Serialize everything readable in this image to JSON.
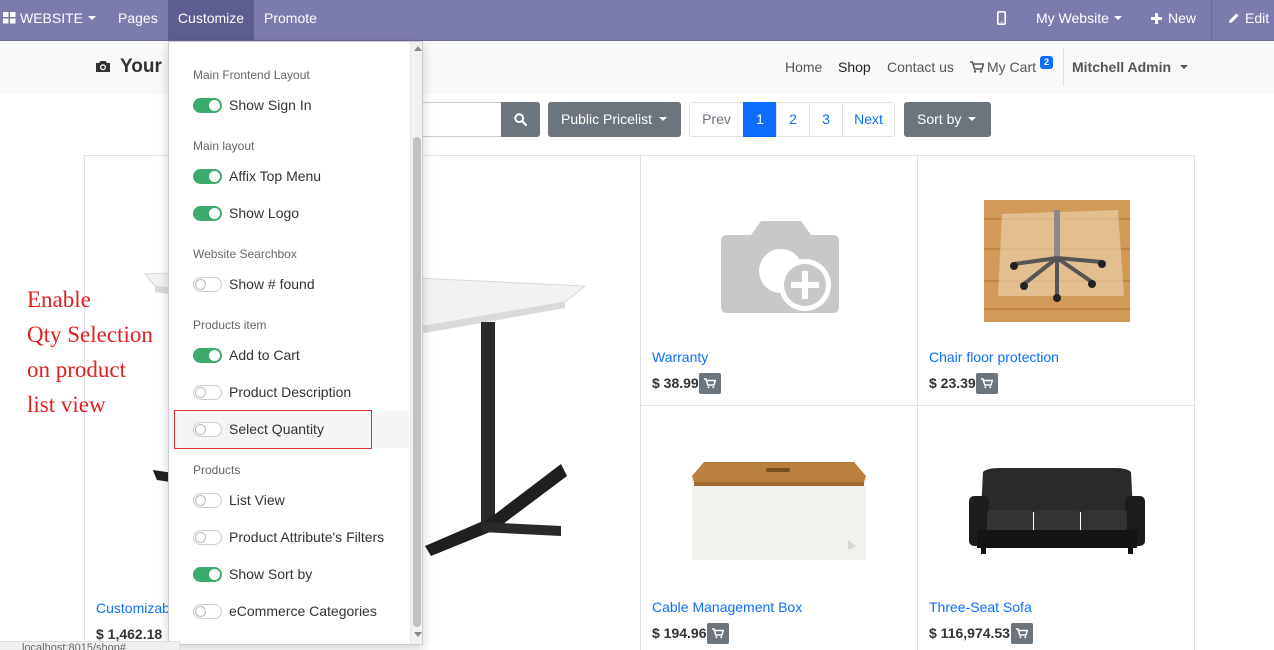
{
  "admin_bar": {
    "website_menu": "WEBSITE",
    "pages": "Pages",
    "customize": "Customize",
    "promote": "Promote",
    "website_selector": "My Website",
    "new": "New",
    "edit": "Edit"
  },
  "site_header": {
    "logo": "Your",
    "nav": [
      "Home",
      "Shop",
      "Contact us"
    ],
    "active_nav": "Shop",
    "cart_label": "My Cart",
    "cart_count": "2",
    "user": "Mitchell Admin"
  },
  "shop_toolbar": {
    "pricelist": "Public Pricelist",
    "pager": [
      "Prev",
      "1",
      "2",
      "3",
      "Next"
    ],
    "current_page": "1",
    "sort": "Sort by"
  },
  "products": [
    {
      "name": "Customizab",
      "price": "$ 1,462.18"
    },
    {
      "name": "Warranty",
      "price": "$ 38.99"
    },
    {
      "name": "Chair floor protection",
      "price": "$ 23.39"
    },
    {
      "name": "Cable Management Box",
      "price": "$ 194.96"
    },
    {
      "name": "Three-Seat Sofa",
      "price": "$ 116,974.53"
    }
  ],
  "annotation": [
    "Enable",
    "Qty Selection",
    "on product",
    "list view"
  ],
  "customize_menu": {
    "groups": [
      {
        "title": "Main Frontend Layout",
        "options": [
          {
            "label": "Show Sign In",
            "on": true
          }
        ]
      },
      {
        "title": "Main layout",
        "options": [
          {
            "label": "Affix Top Menu",
            "on": true
          },
          {
            "label": "Show Logo",
            "on": true
          }
        ]
      },
      {
        "title": "Website Searchbox",
        "options": [
          {
            "label": "Show # found",
            "on": false
          }
        ]
      },
      {
        "title": "Products item",
        "options": [
          {
            "label": "Add to Cart",
            "on": true
          },
          {
            "label": "Product Description",
            "on": false
          },
          {
            "label": "Select Quantity",
            "on": false
          }
        ]
      },
      {
        "title": "Products",
        "options": [
          {
            "label": "List View",
            "on": false
          },
          {
            "label": "Product Attribute's Filters",
            "on": false
          },
          {
            "label": "Show Sort by",
            "on": true
          },
          {
            "label": "eCommerce Categories",
            "on": false
          }
        ]
      }
    ]
  },
  "status_url": "localhost:8015/shop#"
}
